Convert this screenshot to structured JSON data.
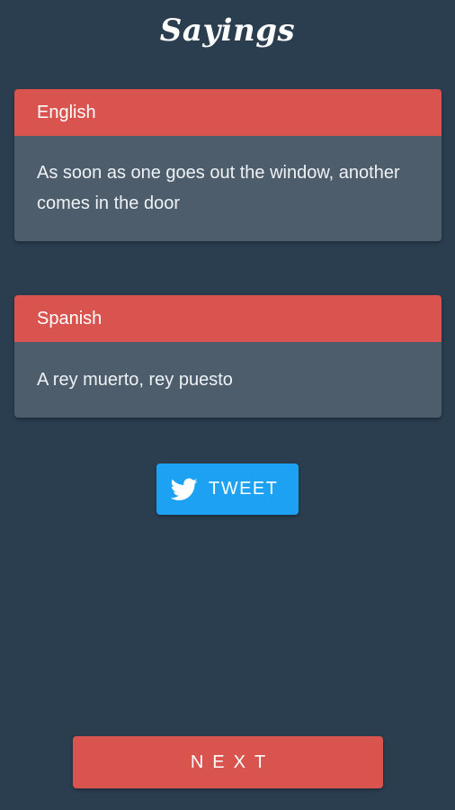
{
  "app": {
    "title": "Sayings"
  },
  "cards": {
    "english": {
      "language": "English",
      "text": "As soon as one goes out the window, another comes in the door"
    },
    "spanish": {
      "language": "Spanish",
      "text": "A rey muerto, rey puesto"
    }
  },
  "actions": {
    "tweet_label": "TWEET",
    "tweet_icon": "twitter-bird-icon",
    "next_label": "NEXT"
  },
  "colors": {
    "background": "#2b3e50",
    "card_header": "#d9534f",
    "card_body": "#4e5d6c",
    "tweet_button": "#1da1f2",
    "next_button": "#d9534f"
  }
}
